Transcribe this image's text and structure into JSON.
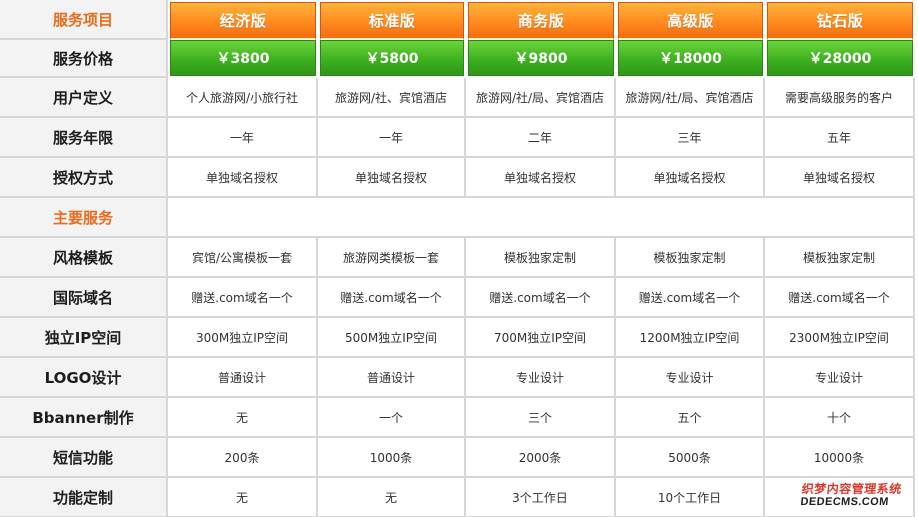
{
  "header": {
    "left_label": "服务项目",
    "plans": [
      {
        "name": "经济版",
        "price": "￥3800"
      },
      {
        "name": "标准版",
        "price": "￥5800"
      },
      {
        "name": "商务版",
        "price": "￥9800"
      },
      {
        "name": "高级版",
        "price": "￥18000"
      },
      {
        "name": "钻石版",
        "price": "￥28000"
      }
    ],
    "price_label": "服务价格"
  },
  "rows": {
    "user_definition": {
      "label": "用户定义",
      "values": [
        "个人旅游网/小旅行社",
        "旅游网/社、宾馆酒店",
        "旅游网/社/局、宾馆酒店",
        "旅游网/社/局、宾馆酒店",
        "需要高级服务的客户"
      ]
    },
    "service_years": {
      "label": "服务年限",
      "values": [
        "一年",
        "一年",
        "二年",
        "三年",
        "五年"
      ]
    },
    "authorization": {
      "label": "授权方式",
      "values": [
        "单独域名授权",
        "单独域名授权",
        "单独域名授权",
        "单独域名授权",
        "单独域名授权"
      ]
    },
    "main_services": {
      "label": "主要服务"
    },
    "style_template": {
      "label": "风格模板",
      "values": [
        "宾馆/公寓模板一套",
        "旅游网类模板一套",
        "模板独家定制",
        "模板独家定制",
        "模板独家定制"
      ]
    },
    "intl_domain": {
      "label": "国际域名",
      "values": [
        "赠送.com域名一个",
        "赠送.com域名一个",
        "赠送.com域名一个",
        "赠送.com域名一个",
        "赠送.com域名一个"
      ]
    },
    "dedicated_ip": {
      "label": "独立IP空间",
      "values": [
        "300M独立IP空间",
        "500M独立IP空间",
        "700M独立IP空间",
        "1200M独立IP空间",
        "2300M独立IP空间"
      ]
    },
    "logo_design": {
      "label": "LOGO设计",
      "values": [
        "普通设计",
        "普通设计",
        "专业设计",
        "专业设计",
        "专业设计"
      ]
    },
    "banner_making": {
      "label": "Bbanner制作",
      "values": [
        "无",
        "一个",
        "三个",
        "五个",
        "十个"
      ]
    },
    "sms_function": {
      "label": "短信功能",
      "values": [
        "200条",
        "1000条",
        "2000条",
        "5000条",
        "10000条"
      ]
    },
    "custom_function": {
      "label": "功能定制",
      "values": [
        "无",
        "无",
        "3个工作日",
        "10个工作日",
        ""
      ]
    }
  },
  "watermark": {
    "line1": "织梦内容管理系统",
    "line2": "DEDECMS.COM"
  },
  "colors": {
    "accent_orange": "#ea6b1a",
    "price_green": "#3eb11f",
    "grid_line": "#d7d7d7",
    "left_column_bg": "#f3f3f3"
  }
}
